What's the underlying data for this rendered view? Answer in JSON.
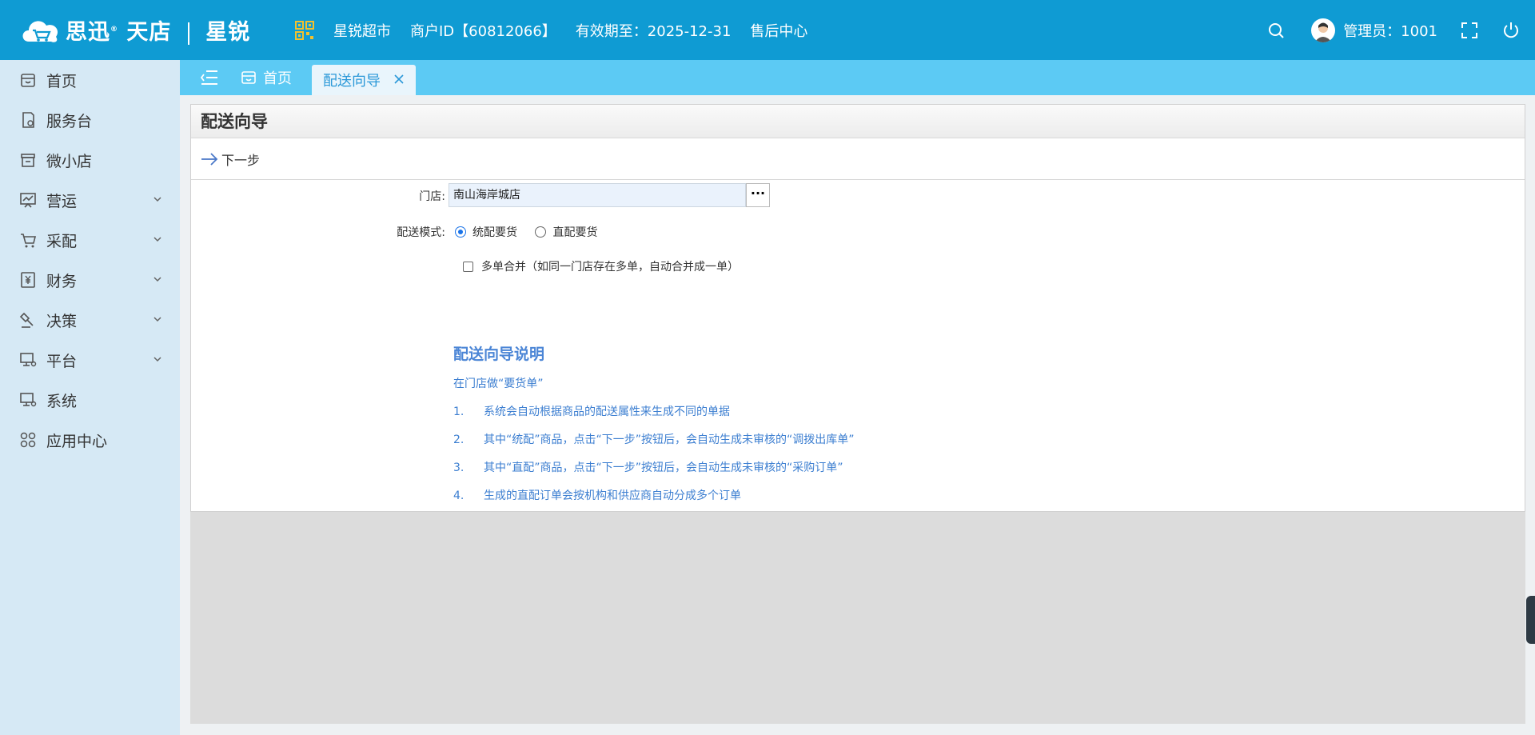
{
  "header": {
    "logo_brand": "思迅",
    "logo_product": "天店",
    "logo_edition": "星锐",
    "store_name": "星锐超市",
    "merchant_id": "商户ID【60812066】",
    "valid_until": "有效期至：2025-12-31",
    "after_sales": "售后中心",
    "admin_label": "管理员：1001"
  },
  "sidebar": {
    "items": [
      {
        "label": "首页",
        "icon": "home-icon"
      },
      {
        "label": "服务台",
        "icon": "service-desk-icon"
      },
      {
        "label": "微小店",
        "icon": "shop-icon"
      },
      {
        "label": "营运",
        "icon": "operations-icon"
      },
      {
        "label": "采配",
        "icon": "cart-icon"
      },
      {
        "label": "财务",
        "icon": "finance-icon"
      },
      {
        "label": "决策",
        "icon": "decision-icon"
      },
      {
        "label": "平台",
        "icon": "platform-icon"
      },
      {
        "label": "系统",
        "icon": "system-icon"
      },
      {
        "label": "应用中心",
        "icon": "app-center-icon"
      }
    ]
  },
  "tabs": {
    "home": "首页",
    "active": "配送向导"
  },
  "panel": {
    "title": "配送向导",
    "next_step": "下一步",
    "store_label": "门店:",
    "store_value": "南山海岸城店",
    "mode_label": "配送模式:",
    "mode_option1": "统配要货",
    "mode_option2": "直配要货",
    "merge_label": "多单合并（如同一门店存在多单，自动合并成一单）"
  },
  "guide": {
    "title": "配送向导说明",
    "intro": "在门店做“要货单”",
    "lines": [
      {
        "n": "1.",
        "text": "系统会自动根据商品的配送属性来生成不同的单据"
      },
      {
        "n": "2.",
        "text": "其中“统配”商品，点击“下一步”按钮后，会自动生成未审核的“调拨出库单”"
      },
      {
        "n": "3.",
        "text": "其中“直配”商品，点击“下一步”按钮后，会自动生成未审核的“采购订单”"
      },
      {
        "n": "4.",
        "text": "生成的直配订单会按机构和供应商自动分成多个订单"
      }
    ]
  }
}
